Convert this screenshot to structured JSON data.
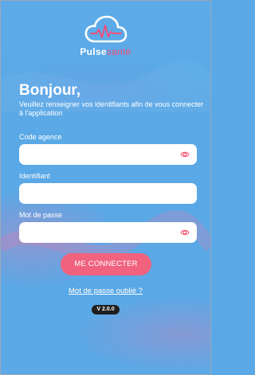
{
  "brand": {
    "name_part1": "Pulse",
    "name_part2": "santé"
  },
  "header": {
    "title": "Bonjour,",
    "subtitle": "Veuillez renseigner vos identifiants afin de vous connecter à l'application"
  },
  "form": {
    "agency_code": {
      "label": "Code agence",
      "value": ""
    },
    "identifier": {
      "label": "Identifiant",
      "value": ""
    },
    "password": {
      "label": "Mot de passe",
      "value": ""
    }
  },
  "actions": {
    "login_label": "ME CONNECTER",
    "forgot_label": "Mot de passe oublié ?"
  },
  "version": "V 2.0.0",
  "icons": {
    "logo": "cloud-heartbeat-icon",
    "reveal": "eye-icon"
  },
  "colors": {
    "background": "#5aa9e6",
    "accent": "#f0627e",
    "brand_accent": "#f0507a",
    "badge": "#1f1f1f"
  }
}
